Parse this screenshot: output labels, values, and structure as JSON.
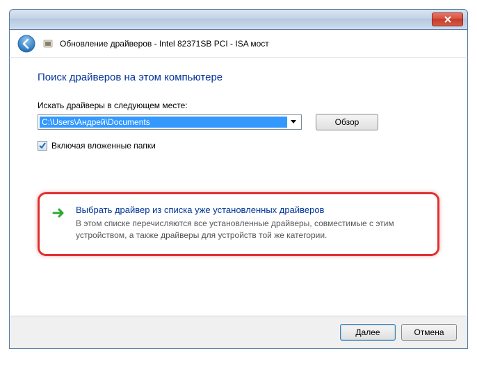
{
  "window": {
    "title": "Обновление драйверов - Intel 82371SB PCI - ISA мост"
  },
  "page": {
    "heading": "Поиск драйверов на этом компьютере",
    "search_label": "Искать драйверы в следующем месте:",
    "path_value": "C:\\Users\\Андрей\\Documents",
    "browse_label": "Обзор",
    "include_subfolders_label": "Включая вложенные папки",
    "include_subfolders_checked": true
  },
  "option": {
    "title": "Выбрать драйвер из списка уже установленных драйверов",
    "description": "В этом списке перечисляются все установленные драйверы, совместимые с этим устройством, а также драйверы для устройств той же категории."
  },
  "buttons": {
    "next": "Далее",
    "cancel": "Отмена"
  }
}
